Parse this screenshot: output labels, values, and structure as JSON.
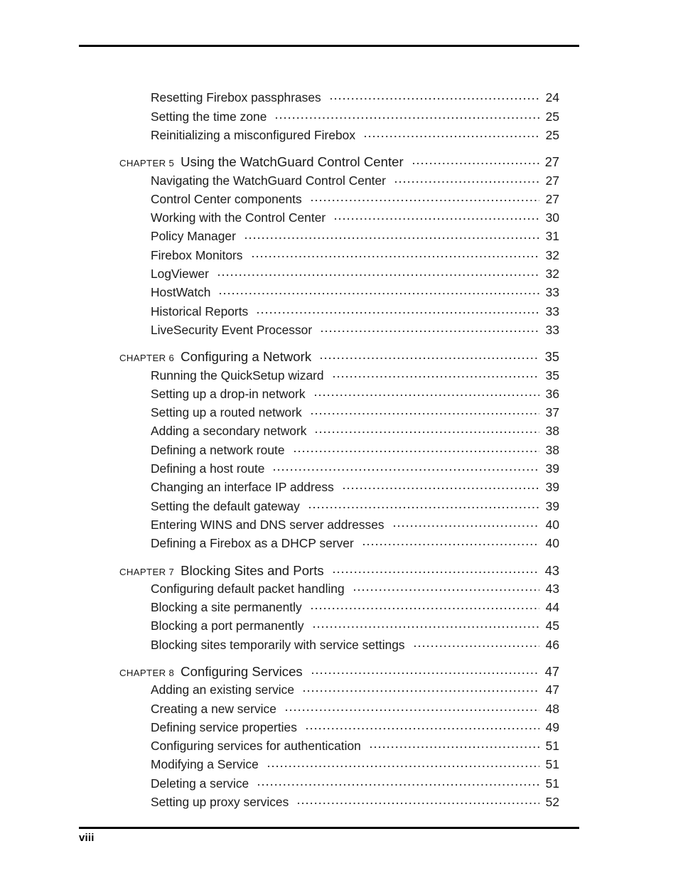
{
  "document": {
    "type": "table-of-contents",
    "folio": "viii"
  },
  "toc": {
    "lines": [
      {
        "kind": "entry",
        "title": "Resetting Firebox passphrases",
        "page": "24"
      },
      {
        "kind": "entry",
        "title": "Setting the time zone",
        "page": "25"
      },
      {
        "kind": "entry",
        "title": "Reinitializing a misconfigured Firebox",
        "page": "25"
      },
      {
        "kind": "chapter",
        "label": "CHAPTER 5",
        "title": "Using the WatchGuard Control Center",
        "page": "27"
      },
      {
        "kind": "entry",
        "title": "Navigating the WatchGuard Control Center",
        "page": "27"
      },
      {
        "kind": "entry",
        "title": "Control Center components",
        "page": "27"
      },
      {
        "kind": "entry",
        "title": "Working with the Control Center",
        "page": "30"
      },
      {
        "kind": "entry",
        "title": "Policy Manager",
        "page": "31"
      },
      {
        "kind": "entry",
        "title": "Firebox Monitors",
        "page": "32"
      },
      {
        "kind": "entry",
        "title": "LogViewer",
        "page": "32"
      },
      {
        "kind": "entry",
        "title": "HostWatch",
        "page": "33"
      },
      {
        "kind": "entry",
        "title": "Historical Reports",
        "page": "33"
      },
      {
        "kind": "entry",
        "title": "LiveSecurity Event Processor",
        "page": "33"
      },
      {
        "kind": "chapter",
        "label": "CHAPTER 6",
        "title": "Configuring a Network",
        "page": "35"
      },
      {
        "kind": "entry",
        "title": "Running the QuickSetup wizard",
        "page": "35"
      },
      {
        "kind": "entry",
        "title": "Setting up a drop-in network",
        "page": "36"
      },
      {
        "kind": "entry",
        "title": "Setting up a routed network",
        "page": "37"
      },
      {
        "kind": "entry",
        "title": "Adding a secondary network",
        "page": "38"
      },
      {
        "kind": "entry",
        "title": "Defining a network route",
        "page": "38"
      },
      {
        "kind": "entry",
        "title": "Defining a host route",
        "page": "39"
      },
      {
        "kind": "entry",
        "title": "Changing an interface IP address",
        "page": "39"
      },
      {
        "kind": "entry",
        "title": "Setting the default gateway",
        "page": "39"
      },
      {
        "kind": "entry",
        "title": "Entering WINS and DNS server addresses",
        "page": "40"
      },
      {
        "kind": "entry",
        "title": "Defining a Firebox as a DHCP server",
        "page": "40"
      },
      {
        "kind": "chapter",
        "label": "CHAPTER 7",
        "title": "Blocking Sites and Ports",
        "page": "43"
      },
      {
        "kind": "entry",
        "title": "Configuring default packet handling",
        "page": "43"
      },
      {
        "kind": "entry",
        "title": "Blocking a site permanently",
        "page": "44"
      },
      {
        "kind": "entry",
        "title": "Blocking a port permanently",
        "page": "45"
      },
      {
        "kind": "entry",
        "title": "Blocking sites temporarily with service settings",
        "page": "46"
      },
      {
        "kind": "chapter",
        "label": "CHAPTER 8",
        "title": "Configuring Services",
        "page": "47"
      },
      {
        "kind": "entry",
        "title": "Adding an existing service",
        "page": "47"
      },
      {
        "kind": "entry",
        "title": "Creating a new service",
        "page": "48"
      },
      {
        "kind": "entry",
        "title": "Defining service properties",
        "page": "49"
      },
      {
        "kind": "entry",
        "title": "Configuring services for authentication",
        "page": "51"
      },
      {
        "kind": "entry",
        "title": "Modifying a Service",
        "page": "51"
      },
      {
        "kind": "entry",
        "title": "Deleting a service",
        "page": "51"
      },
      {
        "kind": "entry",
        "title": "Setting up proxy services",
        "page": "52"
      }
    ]
  }
}
